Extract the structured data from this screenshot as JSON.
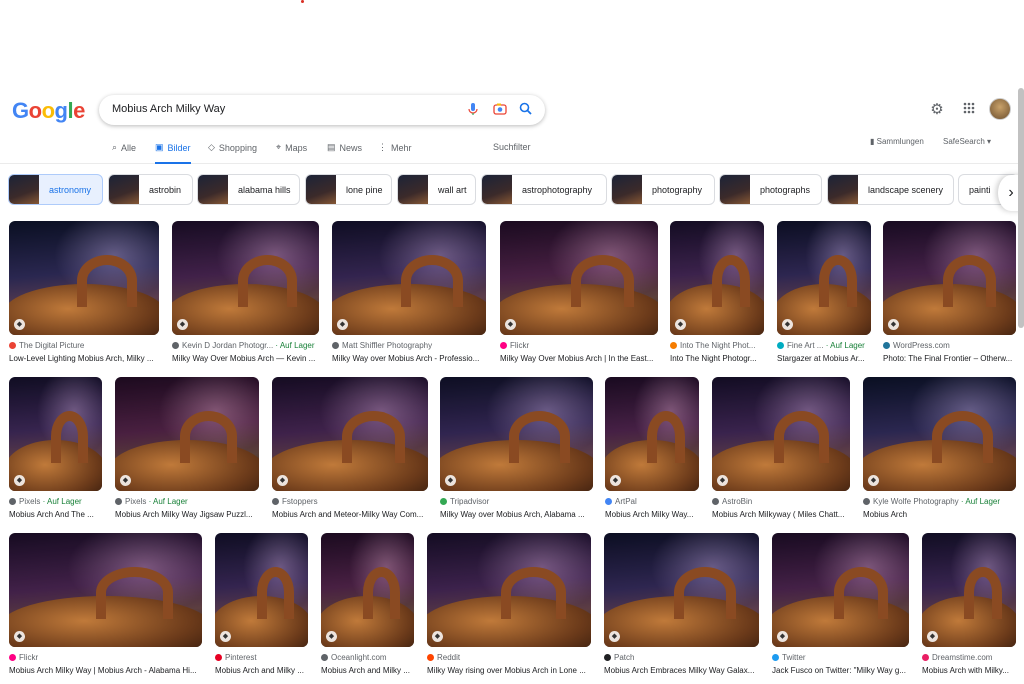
{
  "logo": {
    "letters": [
      "G",
      "o",
      "o",
      "g",
      "l",
      "e"
    ]
  },
  "search": {
    "query": "Mobius Arch Milky Way",
    "icons": [
      "mic-icon",
      "camera-lens-icon",
      "search-icon"
    ]
  },
  "header": {
    "icons": [
      "gear-icon",
      "apps-grid-icon"
    ],
    "avatar": "avatar"
  },
  "tabs": [
    {
      "label": "Alle",
      "icon": "search-icon",
      "active": false
    },
    {
      "label": "Bilder",
      "icon": "image-icon",
      "active": true
    },
    {
      "label": "Shopping",
      "icon": "tag-icon",
      "active": false
    },
    {
      "label": "Maps",
      "icon": "pin-icon",
      "active": false
    },
    {
      "label": "News",
      "icon": "news-icon",
      "active": false
    },
    {
      "label": "Mehr",
      "icon": "more-vert-icon",
      "active": false
    }
  ],
  "toolbar": {
    "filter_label": "Suchfilter",
    "collections_label": "Sammlungen",
    "safesearch_label": "SafeSearch"
  },
  "chips": [
    {
      "label": "astronomy",
      "active": true
    },
    {
      "label": "astrobin",
      "active": false
    },
    {
      "label": "alabama hills",
      "active": false
    },
    {
      "label": "lone pine",
      "active": false
    },
    {
      "label": "wall art",
      "active": false
    },
    {
      "label": "astrophotography",
      "active": false
    },
    {
      "label": "photography",
      "active": false
    },
    {
      "label": "photographs",
      "active": false
    },
    {
      "label": "landscape scenery",
      "active": false
    },
    {
      "label": "painti",
      "active": false
    }
  ],
  "results": [
    {
      "source": "The Digital Picture",
      "stock": "",
      "caption": "Low-Level Lighting Mobius Arch, Milky ...",
      "color": "#ea4335"
    },
    {
      "source": "Kevin D Jordan Photogr...",
      "stock": "Auf Lager",
      "caption": "Milky Way Over Mobius Arch — Kevin ...",
      "color": "#5f6368"
    },
    {
      "source": "Matt Shiffler Photography",
      "stock": "",
      "caption": "Milky Way over Mobius Arch - Professio...",
      "color": "#5f6368"
    },
    {
      "source": "Flickr",
      "stock": "",
      "caption": "Milky Way Over Mobius Arch | In the East...",
      "color": "#ff0084"
    },
    {
      "source": "Into The Night Phot...",
      "stock": "",
      "caption": "Into The Night Photogr...",
      "color": "#f57c00"
    },
    {
      "source": "Fine Art ...",
      "stock": "Auf Lager",
      "caption": "Stargazer at Mobius Ar...",
      "color": "#00acc1"
    },
    {
      "source": "WordPress.com",
      "stock": "",
      "caption": "Photo: The Final Frontier – Otherw...",
      "color": "#21759b"
    },
    {
      "source": "Pixels",
      "stock": "Auf Lager",
      "caption": "Mobius Arch And The ...",
      "color": "#5f6368"
    },
    {
      "source": "Pixels",
      "stock": "Auf Lager",
      "caption": "Mobius Arch Milky Way Jigsaw Puzzl...",
      "color": "#5f6368"
    },
    {
      "source": "Fstoppers",
      "stock": "",
      "caption": "Mobius Arch and Meteor-Milky Way Com...",
      "color": "#5f6368"
    },
    {
      "source": "Tripadvisor",
      "stock": "",
      "caption": "Milky Way over Mobius Arch, Alabama ...",
      "color": "#34a853"
    },
    {
      "source": "ArtPal",
      "stock": "",
      "caption": "Mobius Arch Milky Way...",
      "color": "#4285f4"
    },
    {
      "source": "AstroBin",
      "stock": "",
      "caption": "Mobius Arch Milkyway ( Miles Chatt...",
      "color": "#5f6368"
    },
    {
      "source": "Kyle Wolfe Photography",
      "stock": "Auf Lager",
      "caption": "Mobius Arch",
      "color": "#5f6368"
    },
    {
      "source": "Flickr",
      "stock": "",
      "caption": "Mobius Arch Milky Way | Mobius Arch - Alabama Hi...",
      "color": "#ff0084"
    },
    {
      "source": "Pinterest",
      "stock": "",
      "caption": "Mobius Arch and Milky ...",
      "color": "#e60023"
    },
    {
      "source": "Oceanlight.com",
      "stock": "",
      "caption": "Mobius Arch and Milky ...",
      "color": "#5f6368"
    },
    {
      "source": "Reddit",
      "stock": "",
      "caption": "Milky Way rising over Mobius Arch in Lone ...",
      "color": "#ff4500"
    },
    {
      "source": "Patch",
      "stock": "",
      "caption": "Mobius Arch Embraces Milky Way Galax...",
      "color": "#202124"
    },
    {
      "source": "Twitter",
      "stock": "",
      "caption": "Jack Fusco on Twitter: \"Milky Way g...",
      "color": "#1d9bf0"
    },
    {
      "source": "Dreamstime.com",
      "stock": "",
      "caption": "Mobius Arch with Milky...",
      "color": "#e91e63"
    }
  ]
}
